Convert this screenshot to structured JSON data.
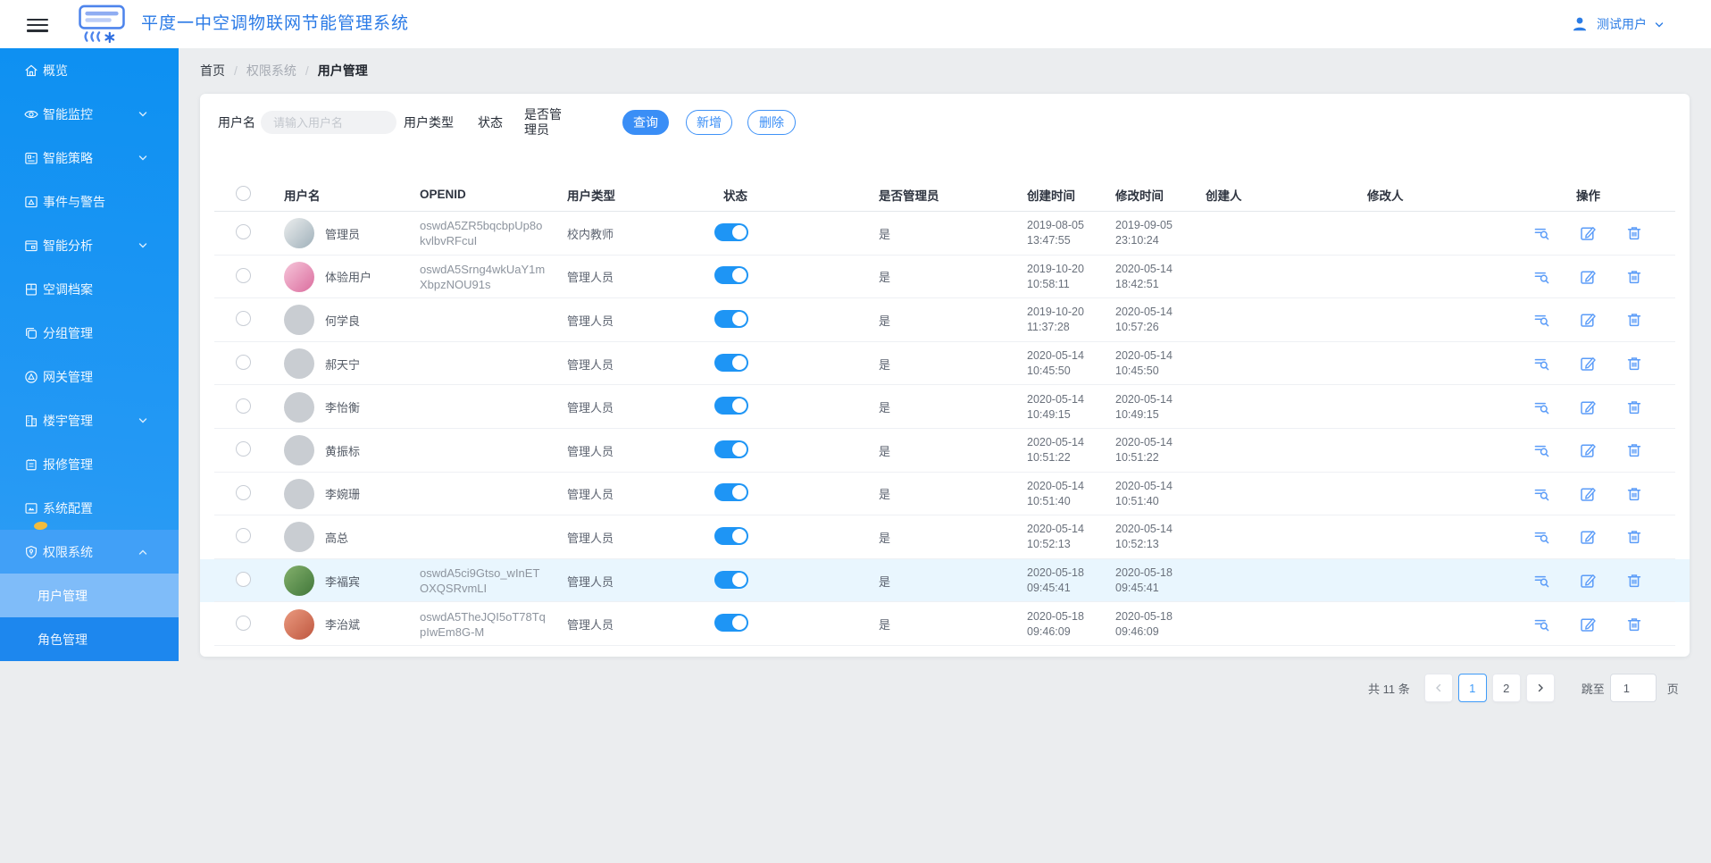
{
  "header": {
    "title": "平度一中空调物联网节能管理系统",
    "user_name": "测试用户"
  },
  "sidebar": {
    "items": [
      {
        "label": "概览",
        "icon": "home",
        "chevron": null,
        "badge": false,
        "section": false
      },
      {
        "label": "智能监控",
        "icon": "eye",
        "chevron": "down",
        "badge": false,
        "section": false
      },
      {
        "label": "智能策略",
        "icon": "strategy",
        "chevron": "down",
        "badge": false,
        "section": false
      },
      {
        "label": "事件与警告",
        "icon": "event-alert",
        "chevron": null,
        "badge": false,
        "section": false
      },
      {
        "label": "智能分析",
        "icon": "analysis",
        "chevron": "down",
        "badge": false,
        "section": false
      },
      {
        "label": "空调档案",
        "icon": "ac-archive",
        "chevron": null,
        "badge": false,
        "section": false
      },
      {
        "label": "分组管理",
        "icon": "group",
        "chevron": null,
        "badge": false,
        "section": false
      },
      {
        "label": "网关管理",
        "icon": "gateway",
        "chevron": null,
        "badge": false,
        "section": false
      },
      {
        "label": "楼宇管理",
        "icon": "building",
        "chevron": "down",
        "badge": false,
        "section": false
      },
      {
        "label": "报修管理",
        "icon": "repair",
        "chevron": null,
        "badge": false,
        "section": false
      },
      {
        "label": "系统配置",
        "icon": "system-config",
        "chevron": null,
        "badge": true,
        "section": false
      },
      {
        "label": "权限系统",
        "icon": "permission",
        "chevron": "up",
        "badge": false,
        "section": true
      }
    ],
    "submenu": [
      {
        "label": "用户管理",
        "active": true
      },
      {
        "label": "角色管理",
        "active": false
      }
    ]
  },
  "breadcrumb": {
    "home": "首页",
    "separator": "/",
    "section": "权限系统",
    "current": "用户管理"
  },
  "filters": {
    "username_label": "用户名",
    "username_placeholder": "请输入用户名",
    "username_value": "",
    "type_label": "用户类型",
    "status_label": "状态",
    "admin_label": "是否管理员",
    "search_label": "查询",
    "add_label": "新增",
    "delete_label": "删除"
  },
  "table": {
    "columns": [
      "",
      "用户名",
      "OPENID",
      "用户类型",
      "状态",
      "是否管理员",
      "创建时间",
      "修改时间",
      "创建人",
      "修改人",
      "操作"
    ],
    "actions": [
      "view-detail",
      "edit",
      "delete"
    ],
    "rows": [
      {
        "name": "管理员",
        "openid": [
          "oswdA5ZR5bqcbpUp8o",
          "kvlbvRFcuI"
        ],
        "type": "校内教师",
        "status": true,
        "admin": "是",
        "created": [
          "2019-08-05",
          "13:47:55"
        ],
        "modified": [
          "2019-09-05",
          "23:10:24"
        ],
        "creator": "",
        "modifier": "",
        "avatar": [
          "#eceeee",
          "#9fb0ba"
        ],
        "highlighted": false
      },
      {
        "name": "体验用户",
        "openid": [
          "oswdA5Srng4wkUaY1m",
          "XbpzNOU91s"
        ],
        "type": "管理人员",
        "status": true,
        "admin": "是",
        "created": [
          "2019-10-20",
          "10:58:11"
        ],
        "modified": [
          "2020-05-14",
          "18:42:51"
        ],
        "creator": "",
        "modifier": "",
        "avatar": [
          "#f6c6da",
          "#db6d9e"
        ],
        "highlighted": false
      },
      {
        "name": "何学良",
        "openid": [],
        "type": "管理人员",
        "status": true,
        "admin": "是",
        "created": [
          "2019-10-20",
          "11:37:28"
        ],
        "modified": [
          "2020-05-14",
          "10:57:26"
        ],
        "creator": "",
        "modifier": "",
        "avatar": null,
        "highlighted": false
      },
      {
        "name": "郝天宁",
        "openid": [],
        "type": "管理人员",
        "status": true,
        "admin": "是",
        "created": [
          "2020-05-14",
          "10:45:50"
        ],
        "modified": [
          "2020-05-14",
          "10:45:50"
        ],
        "creator": "",
        "modifier": "",
        "avatar": null,
        "highlighted": false
      },
      {
        "name": "李怡衡",
        "openid": [],
        "type": "管理人员",
        "status": true,
        "admin": "是",
        "created": [
          "2020-05-14",
          "10:49:15"
        ],
        "modified": [
          "2020-05-14",
          "10:49:15"
        ],
        "creator": "",
        "modifier": "",
        "avatar": null,
        "highlighted": false
      },
      {
        "name": "黄振标",
        "openid": [],
        "type": "管理人员",
        "status": true,
        "admin": "是",
        "created": [
          "2020-05-14",
          "10:51:22"
        ],
        "modified": [
          "2020-05-14",
          "10:51:22"
        ],
        "creator": "",
        "modifier": "",
        "avatar": null,
        "highlighted": false
      },
      {
        "name": "李婉珊",
        "openid": [],
        "type": "管理人员",
        "status": true,
        "admin": "是",
        "created": [
          "2020-05-14",
          "10:51:40"
        ],
        "modified": [
          "2020-05-14",
          "10:51:40"
        ],
        "creator": "",
        "modifier": "",
        "avatar": null,
        "highlighted": false
      },
      {
        "name": "高总",
        "openid": [],
        "type": "管理人员",
        "status": true,
        "admin": "是",
        "created": [
          "2020-05-14",
          "10:52:13"
        ],
        "modified": [
          "2020-05-14",
          "10:52:13"
        ],
        "creator": "",
        "modifier": "",
        "avatar": null,
        "highlighted": false
      },
      {
        "name": "李福宾",
        "openid": [
          "oswdA5ci9Gtso_wInET",
          "OXQSRvmLI"
        ],
        "type": "管理人员",
        "status": true,
        "admin": "是",
        "created": [
          "2020-05-18",
          "09:45:41"
        ],
        "modified": [
          "2020-05-18",
          "09:45:41"
        ],
        "creator": "",
        "modifier": "",
        "avatar": [
          "#83b06c",
          "#41773a"
        ],
        "highlighted": true
      },
      {
        "name": "李治斌",
        "openid": [
          "oswdA5TheJQI5oT78Tq",
          "pIwEm8G-M"
        ],
        "type": "管理人员",
        "status": true,
        "admin": "是",
        "created": [
          "2020-05-18",
          "09:46:09"
        ],
        "modified": [
          "2020-05-18",
          "09:46:09"
        ],
        "creator": "",
        "modifier": "",
        "avatar": [
          "#ea9a7f",
          "#bf5740"
        ],
        "highlighted": false
      }
    ]
  },
  "pagination": {
    "total_text": "共 11 条",
    "pages": [
      {
        "label": "1",
        "active": true
      },
      {
        "label": "2",
        "active": false
      }
    ],
    "jump_label": "跳至",
    "jump_value": "1",
    "page_unit": "页"
  },
  "colors": {
    "accent": "#3a8ef6",
    "sidebar_blue": "#1794f3",
    "submenu_active": "#7fbcf9",
    "toggle_on": "#1e95f5",
    "highlight_row": "#e9f6fe",
    "badge_dot": "#f1bc3e",
    "title_blue": "#2a7ae6"
  }
}
